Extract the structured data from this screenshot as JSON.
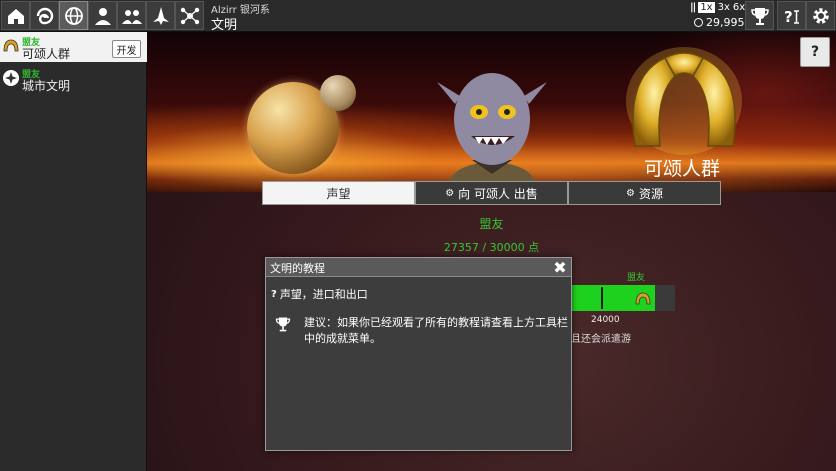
{
  "topbar": {
    "buttons": [
      {
        "name": "home-icon"
      },
      {
        "name": "galaxy-icon"
      },
      {
        "name": "civilizations-icon"
      },
      {
        "name": "empire-leader-icon"
      },
      {
        "name": "people-icon"
      },
      {
        "name": "fleet-icon"
      },
      {
        "name": "network-icon"
      }
    ],
    "galaxy_name": "Alzirr 银河系",
    "screen_title": "文明",
    "speed": {
      "pause": "||",
      "options": [
        "1x",
        "3x",
        "6x"
      ],
      "selected": "1x"
    },
    "money": "29,995",
    "right_buttons": [
      {
        "name": "trophy-icon"
      },
      {
        "name": "help-icon"
      },
      {
        "name": "settings-icon"
      }
    ]
  },
  "sidebar": {
    "items": [
      {
        "status": "盟友",
        "name": "可颂人群",
        "selected": true,
        "action": "开发"
      },
      {
        "status": "盟友",
        "name": "城市文明",
        "selected": false
      }
    ]
  },
  "main": {
    "civ_name": "可颂人群",
    "help_label": "?",
    "tabs": [
      {
        "label": "声望",
        "active": true
      },
      {
        "label": "向 可颂人 出售",
        "active": false
      },
      {
        "label": "资源",
        "active": false
      }
    ],
    "reputation": {
      "status": "盟友",
      "points": "27357 / 30000 点",
      "fraction": 0.91
    },
    "threshold": {
      "label": "盟友",
      "value": "24000"
    },
    "behind_text": "且还会派遣游"
  },
  "dialog": {
    "title": "文明的教程",
    "close": "✖",
    "subtitle": "声望，进口和出口",
    "tip": "建议：如果你已经观看了所有的教程请查看上方工具栏中的成就菜单。"
  },
  "colors": {
    "ally_green": "#35c835",
    "bar_green": "#1fd11f",
    "gold": "#d9a21e"
  }
}
